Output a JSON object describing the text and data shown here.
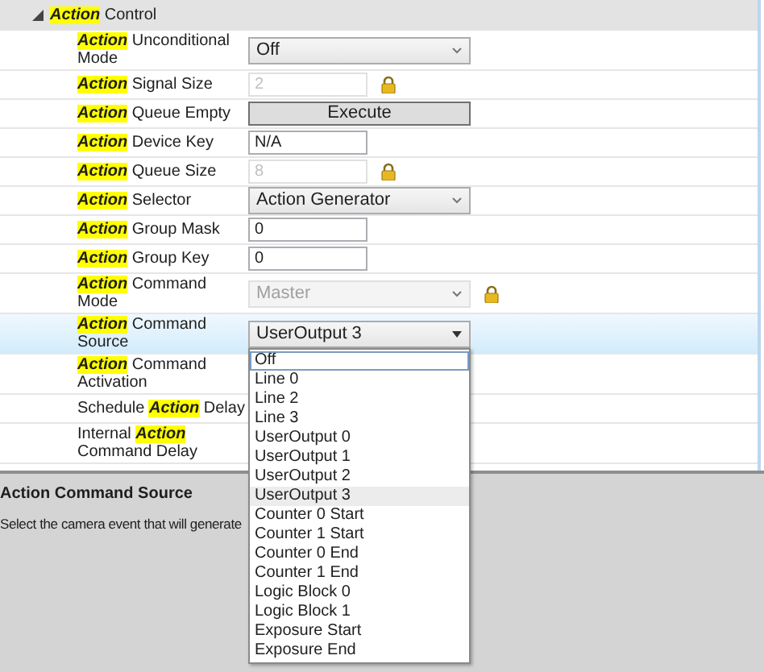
{
  "category": {
    "expanded": true,
    "label": [
      {
        "text": "Action",
        "highlight": true
      },
      {
        "text": " Control",
        "highlight": false
      }
    ]
  },
  "rows": [
    {
      "label": [
        {
          "text": "Action",
          "highlight": true
        },
        {
          "text": " Unconditional Mode",
          "highlight": false
        }
      ],
      "selected": false,
      "value": {
        "kind": "dropdown",
        "text": "Off",
        "disabled": false
      }
    },
    {
      "label": [
        {
          "text": "Action",
          "highlight": true
        },
        {
          "text": " Signal Size",
          "highlight": false
        }
      ],
      "selected": false,
      "value": {
        "kind": "field",
        "text": "2",
        "disabled": true
      }
    },
    {
      "label": [
        {
          "text": "Action",
          "highlight": true
        },
        {
          "text": " Queue Empty",
          "highlight": false
        }
      ],
      "selected": false,
      "value": {
        "kind": "button",
        "text": "Execute",
        "disabled": false
      }
    },
    {
      "label": [
        {
          "text": "Action",
          "highlight": true
        },
        {
          "text": " Device Key",
          "highlight": false
        }
      ],
      "selected": false,
      "value": {
        "kind": "field",
        "text": "N/A",
        "disabled": false
      }
    },
    {
      "label": [
        {
          "text": "Action",
          "highlight": true
        },
        {
          "text": " Queue Size",
          "highlight": false
        }
      ],
      "selected": false,
      "value": {
        "kind": "field",
        "text": "8",
        "disabled": true
      }
    },
    {
      "label": [
        {
          "text": "Action",
          "highlight": true
        },
        {
          "text": " Selector",
          "highlight": false
        }
      ],
      "selected": false,
      "value": {
        "kind": "dropdown",
        "text": "Action Generator",
        "disabled": false
      }
    },
    {
      "label": [
        {
          "text": "Action",
          "highlight": true
        },
        {
          "text": " Group Mask",
          "highlight": false
        }
      ],
      "selected": false,
      "value": {
        "kind": "field",
        "text": "0",
        "disabled": false
      }
    },
    {
      "label": [
        {
          "text": "Action",
          "highlight": true
        },
        {
          "text": " Group Key",
          "highlight": false
        }
      ],
      "selected": false,
      "value": {
        "kind": "field",
        "text": "0",
        "disabled": false
      }
    },
    {
      "label": [
        {
          "text": "Action",
          "highlight": true
        },
        {
          "text": " Command Mode",
          "highlight": false
        }
      ],
      "selected": false,
      "value": {
        "kind": "dropdown",
        "text": "Master",
        "disabled": true
      }
    },
    {
      "label": [
        {
          "text": "Action",
          "highlight": true
        },
        {
          "text": " Command Source",
          "highlight": false
        }
      ],
      "selected": true,
      "value": {
        "kind": "dropdown",
        "text": "UserOutput 3",
        "disabled": false,
        "expanded": true,
        "options": [
          {
            "text": "Off",
            "selected": false,
            "focused": true
          },
          {
            "text": "Line 0",
            "selected": false,
            "focused": false
          },
          {
            "text": "Line 2",
            "selected": false,
            "focused": false
          },
          {
            "text": "Line 3",
            "selected": false,
            "focused": false
          },
          {
            "text": "UserOutput 0",
            "selected": false,
            "focused": false
          },
          {
            "text": "UserOutput 1",
            "selected": false,
            "focused": false
          },
          {
            "text": "UserOutput 2",
            "selected": false,
            "focused": false
          },
          {
            "text": "UserOutput 3",
            "selected": true,
            "focused": false
          },
          {
            "text": "Counter 0 Start",
            "selected": false,
            "focused": false
          },
          {
            "text": "Counter 1 Start",
            "selected": false,
            "focused": false
          },
          {
            "text": "Counter 0 End",
            "selected": false,
            "focused": false
          },
          {
            "text": "Counter 1 End",
            "selected": false,
            "focused": false
          },
          {
            "text": "Logic Block 0",
            "selected": false,
            "focused": false
          },
          {
            "text": "Logic Block 1",
            "selected": false,
            "focused": false
          },
          {
            "text": "Exposure Start",
            "selected": false,
            "focused": false
          },
          {
            "text": "Exposure End",
            "selected": false,
            "focused": false
          }
        ]
      }
    },
    {
      "label": [
        {
          "text": "Action",
          "highlight": true
        },
        {
          "text": " Command Activation",
          "highlight": false
        }
      ],
      "selected": false
    },
    {
      "label": [
        {
          "text": "Schedule ",
          "highlight": false
        },
        {
          "text": "Action",
          "highlight": true
        },
        {
          "text": " Delay",
          "highlight": false
        }
      ],
      "selected": false
    },
    {
      "label": [
        {
          "text": "Internal ",
          "highlight": false
        },
        {
          "text": "Action",
          "highlight": true
        },
        {
          "text": " Command Delay",
          "highlight": false
        }
      ],
      "selected": false
    }
  ],
  "description": {
    "title": "Action Command Source",
    "text": "Select the camera event that will generate"
  }
}
